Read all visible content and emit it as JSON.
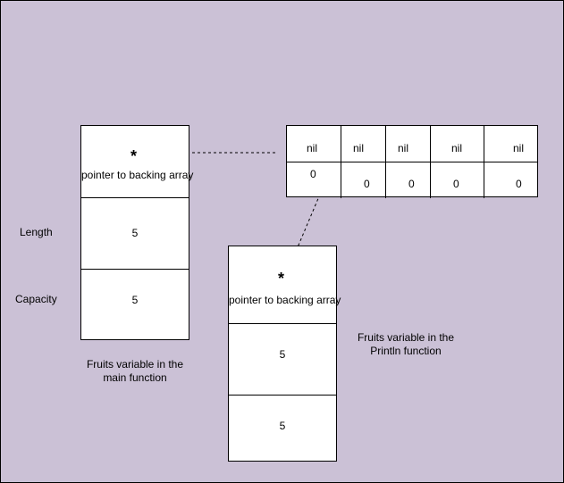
{
  "main_struct": {
    "pointer_symbol": "*",
    "pointer_label": "pointer to backing array",
    "length_value": "5",
    "capacity_value": "5",
    "caption_line1": "Fruits variable in the",
    "caption_line2": "main function"
  },
  "side_labels": {
    "length": "Length",
    "capacity": "Capacity"
  },
  "println_struct": {
    "pointer_symbol": "*",
    "pointer_label": "pointer to backing array",
    "length_value": "5",
    "capacity_value": "5",
    "caption_line1": "Fruits variable in the",
    "caption_line2": "Println function"
  },
  "backing_array": {
    "top_row": [
      "nil",
      "nil",
      "nil",
      "nil",
      "nil"
    ],
    "bottom_row": [
      "0",
      "0",
      "0",
      "0",
      "0"
    ]
  },
  "colors": {
    "background": "#cbc1d6",
    "box_fill": "#ffffff",
    "stroke": "#000000"
  }
}
